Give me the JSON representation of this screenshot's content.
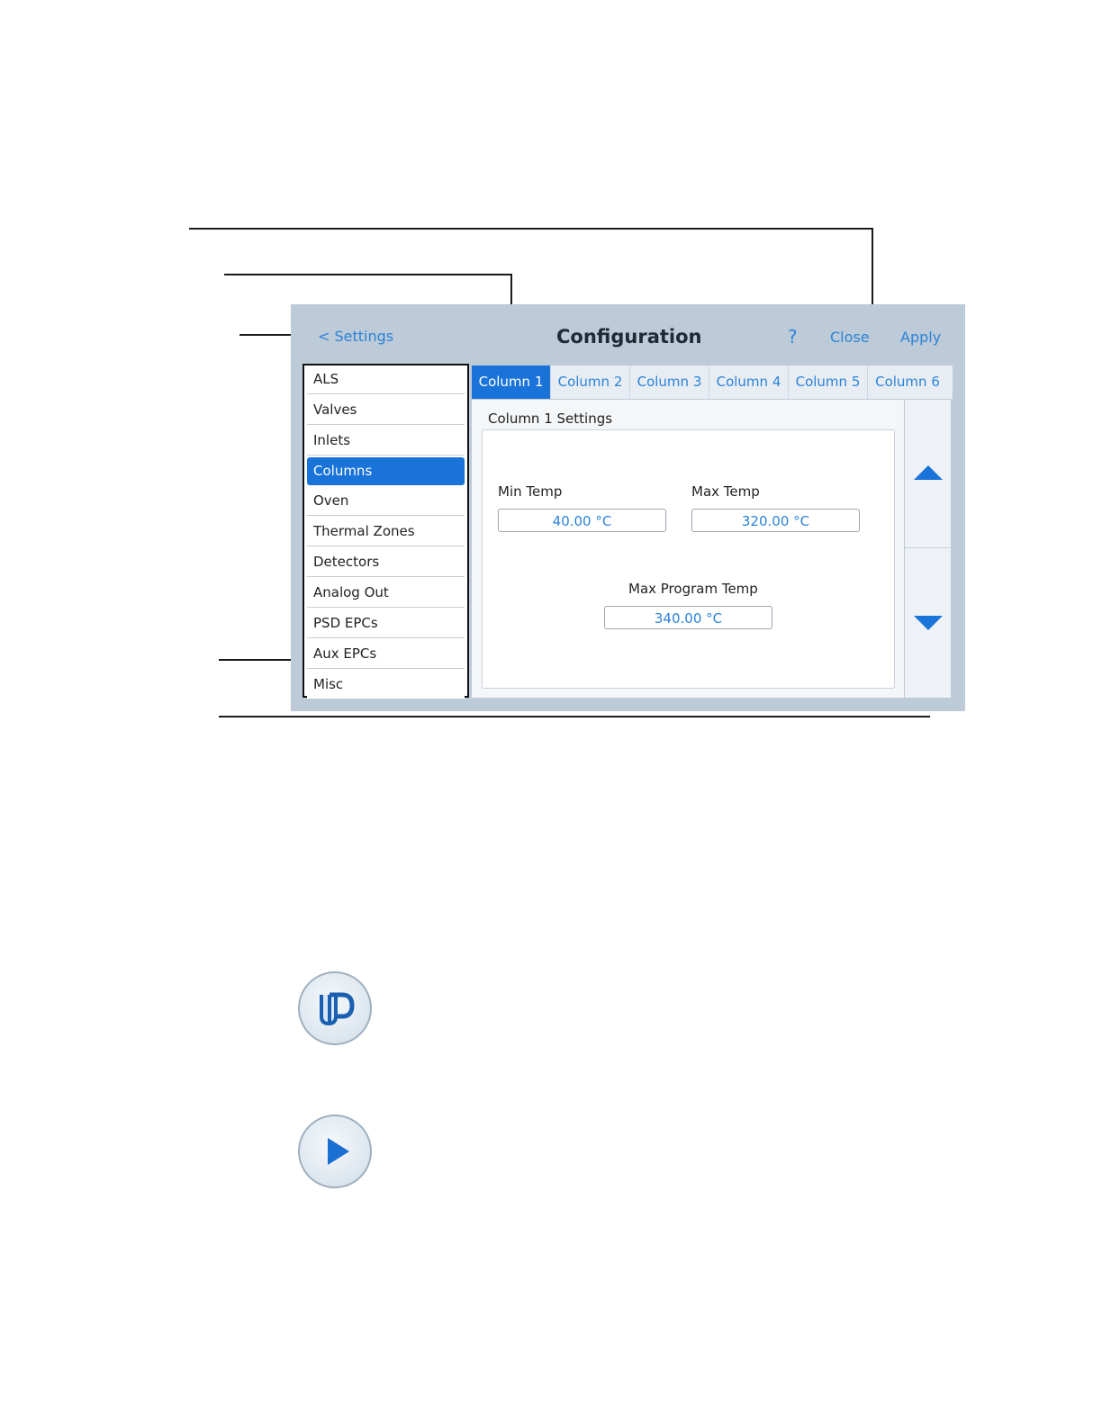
{
  "header": {
    "back_label": "< Settings",
    "title": "Configuration",
    "help_label": "?",
    "close_label": "Close",
    "apply_label": "Apply"
  },
  "sidebar": {
    "items": [
      {
        "label": "ALS",
        "active": false
      },
      {
        "label": "Valves",
        "active": false
      },
      {
        "label": "Inlets",
        "active": false
      },
      {
        "label": "Columns",
        "active": true
      },
      {
        "label": "Oven",
        "active": false
      },
      {
        "label": "Thermal Zones",
        "active": false
      },
      {
        "label": "Detectors",
        "active": false
      },
      {
        "label": "Analog Out",
        "active": false
      },
      {
        "label": "PSD EPCs",
        "active": false
      },
      {
        "label": "Aux EPCs",
        "active": false
      },
      {
        "label": "Misc",
        "active": false
      }
    ]
  },
  "tabs": [
    {
      "label": "Column 1",
      "active": true
    },
    {
      "label": "Column 2",
      "active": false
    },
    {
      "label": "Column 3",
      "active": false
    },
    {
      "label": "Column 4",
      "active": false
    },
    {
      "label": "Column 5",
      "active": false
    },
    {
      "label": "Column 6",
      "active": false
    }
  ],
  "panel": {
    "caption": "Column 1 Settings",
    "min_temp_label": "Min Temp",
    "min_temp_value": "40.00 °C",
    "max_temp_label": "Max Temp",
    "max_temp_value": "320.00 °C",
    "max_program_temp_label": "Max Program Temp",
    "max_program_temp_value": "340.00 °C"
  },
  "colors": {
    "accent": "#1a73d8",
    "link": "#2b83d8",
    "screen_background": "#bdcad7"
  },
  "icons": {
    "method_icon": "method-icon",
    "start_icon": "play-icon"
  }
}
